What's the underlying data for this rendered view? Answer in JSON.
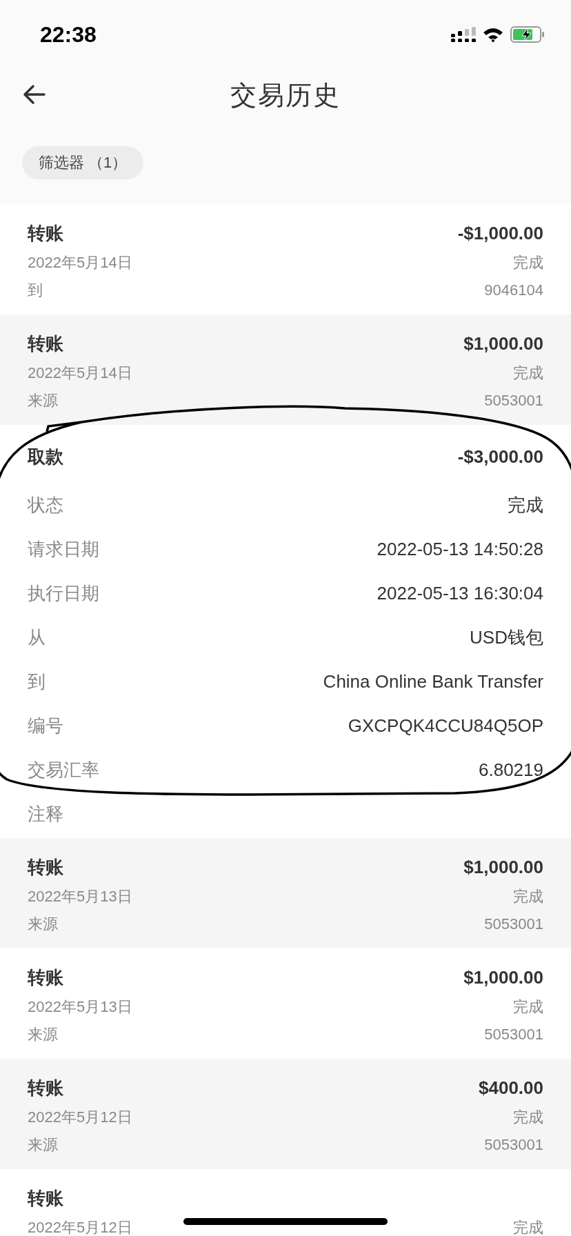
{
  "status_bar": {
    "time": "22:38"
  },
  "header": {
    "title": "交易历史"
  },
  "filter": {
    "label": "筛选器 （1）"
  },
  "transactions": [
    {
      "kind": "summary",
      "type": "转账",
      "amount": "-$1,000.00",
      "date": "2022年5月14日",
      "status": "完成",
      "direction": "到",
      "account": "9046104"
    },
    {
      "kind": "summary",
      "type": "转账",
      "amount": "$1,000.00",
      "date": "2022年5月14日",
      "status": "完成",
      "direction": "来源",
      "account": "5053001"
    },
    {
      "kind": "detail",
      "type": "取款",
      "amount": "-$3,000.00",
      "fields": [
        {
          "label": "状态",
          "value": "完成"
        },
        {
          "label": "请求日期",
          "value": "2022-05-13 14:50:28"
        },
        {
          "label": "执行日期",
          "value": "2022-05-13 16:30:04"
        },
        {
          "label": "从",
          "value": "USD钱包"
        },
        {
          "label": "到",
          "value": "China Online Bank Transfer"
        },
        {
          "label": "编号",
          "value": "GXCPQK4CCU84Q5OP"
        },
        {
          "label": "交易汇率",
          "value": "6.80219"
        },
        {
          "label": "注释"
        }
      ]
    },
    {
      "kind": "summary",
      "type": "转账",
      "amount": "$1,000.00",
      "date": "2022年5月13日",
      "status": "完成",
      "direction": "来源",
      "account": "5053001"
    },
    {
      "kind": "summary",
      "type": "转账",
      "amount": "$1,000.00",
      "date": "2022年5月13日",
      "status": "完成",
      "direction": "来源",
      "account": "5053001"
    },
    {
      "kind": "summary",
      "type": "转账",
      "amount": "$400.00",
      "date": "2022年5月12日",
      "status": "完成",
      "direction": "来源",
      "account": "5053001"
    },
    {
      "kind": "summary",
      "type": "转账",
      "date": "2022年5月12日",
      "status": "完成"
    }
  ],
  "annotation": {
    "kind": "freehand-ellipse"
  }
}
